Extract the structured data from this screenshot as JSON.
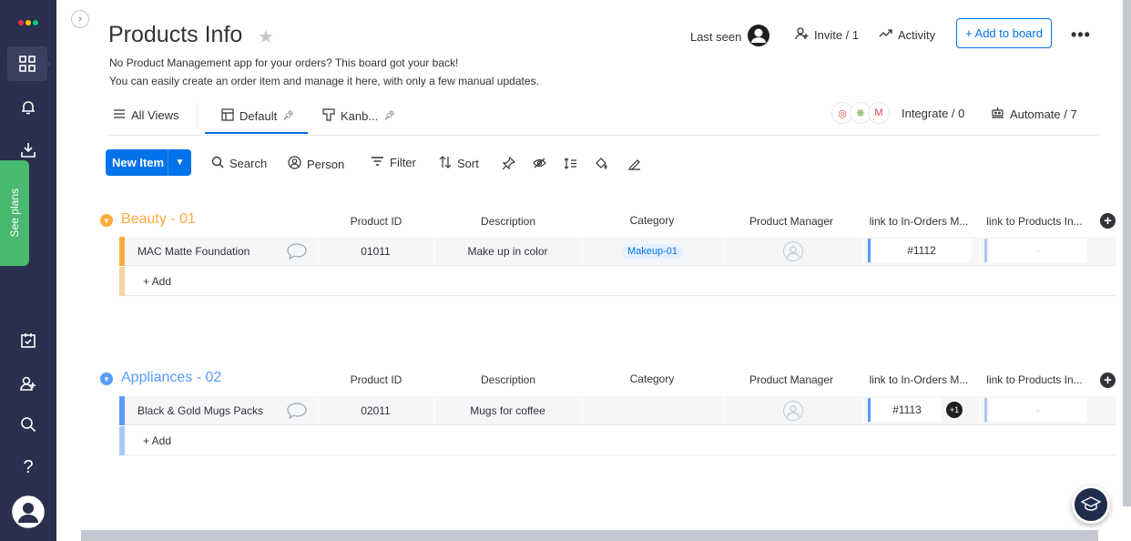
{
  "sidebar": {
    "see_plans": "See plans"
  },
  "header": {
    "title": "Products Info",
    "desc1": "No Product Management app for your orders? This board got your back!",
    "desc2": "You can easily create an order item and manage it here, with only a few manual updates.",
    "last_seen": "Last seen",
    "invite": "Invite / 1",
    "activity": "Activity",
    "add_to_board": "+ Add to board"
  },
  "views": {
    "all_views": "All Views",
    "default": "Default",
    "kanban": "Kanb...",
    "integrate": "Integrate / 0",
    "automate": "Automate / 7"
  },
  "toolbar": {
    "new_item": "New Item",
    "search": "Search",
    "person": "Person",
    "filter": "Filter",
    "sort": "Sort"
  },
  "columns": [
    "Product ID",
    "Description",
    "Category",
    "Product Manager",
    "link to In-Orders M...",
    "link to Products In..."
  ],
  "groups": [
    {
      "title": "Beauty - 01",
      "color": "#fdab3d",
      "light": "#f7d5a3",
      "item": {
        "name": "MAC Matte Foundation",
        "product_id": "01011",
        "description": "Make up in color",
        "category": "Makeup-01",
        "orders_link": "#1112",
        "products_link": "-"
      },
      "add": "+ Add"
    },
    {
      "title": "Appliances - 02",
      "color": "#579bfc",
      "light": "#a9c9f5",
      "item": {
        "name": "Black & Gold Mugs Packs",
        "product_id": "02011",
        "description": "Mugs for coffee",
        "category": "",
        "orders_link": "#1113",
        "orders_extra": "+1",
        "products_link": "-"
      },
      "add": "+ Add"
    }
  ]
}
